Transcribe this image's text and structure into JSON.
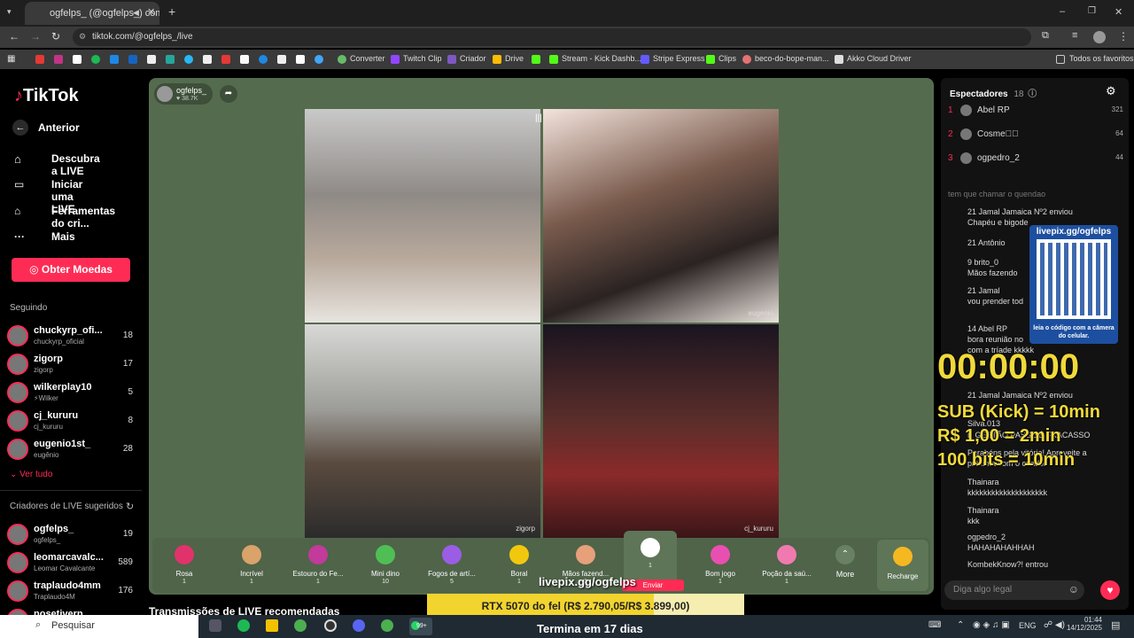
{
  "browser": {
    "tab_title": "ogfelps_ (@ogfelps_) come...",
    "url": "tiktok.com/@ogfelps_/live",
    "bookmarks": [
      "Converter",
      "Twitch Clip",
      "Criador",
      "Drive",
      "Stream - Kick Dashb...",
      "Stripe Express",
      "Clips",
      "beco-do-bope-man...",
      "Akko Cloud Driver",
      "Todos os favoritos"
    ]
  },
  "sidebar": {
    "logo": "TikTok",
    "back": "Anterior",
    "nav": [
      "Descubra a LIVE",
      "Iniciar uma LIVE",
      "Ferramentas do cri...",
      "Mais"
    ],
    "coins_button": "Obter Moedas",
    "following_title": "Seguindo",
    "following": [
      {
        "name": "chuckyrp_ofi...",
        "sub": "chuckyrp_oficial",
        "count": "18"
      },
      {
        "name": "zigorp",
        "sub": "zigorp",
        "count": "17"
      },
      {
        "name": "wilkerplay10",
        "sub": "⚡Wilker",
        "count": "5"
      },
      {
        "name": "cj_kururu",
        "sub": "cj_kururu",
        "count": "8"
      },
      {
        "name": "eugenio1st_",
        "sub": "eugênio",
        "count": "28"
      }
    ],
    "see_all": "Ver tudo",
    "suggested_title": "Criadores de LIVE sugeridos",
    "suggested": [
      {
        "name": "ogfelps_",
        "sub": "ogfelps_",
        "count": "19"
      },
      {
        "name": "leomarcavalc...",
        "sub": "Leomar Cavalcante",
        "count": "589"
      },
      {
        "name": "traplaudo4mm",
        "sub": "Traplaudo4M",
        "count": "176"
      },
      {
        "name": "nosetiverp",
        "sub": "",
        "count": ""
      }
    ]
  },
  "stream": {
    "host": "ogfelps_",
    "likes": "38.7K",
    "tiles": [
      "",
      "eugenio",
      "zigorp",
      "cj_kururu"
    ],
    "recommended_title": "Transmissões de LIVE recomendadas",
    "overlay_link": "livepix.gg/ogfelps",
    "goal": "RTX 5070 do fel (R$ 2.790,05/R$ 3.899,00)",
    "goal_progress": 0.7156,
    "ends": "Termina em 17 dias"
  },
  "gifts": [
    {
      "name": "Rosa",
      "cost": "1",
      "color": "#e0336b"
    },
    {
      "name": "Incrível",
      "cost": "1",
      "color": "#d9a36a"
    },
    {
      "name": "Estouro do Fe...",
      "cost": "1",
      "color": "#c23a9a"
    },
    {
      "name": "Mini dino",
      "cost": "10",
      "color": "#4fbf55"
    },
    {
      "name": "Fogos de artí...",
      "cost": "5",
      "color": "#9b5de5"
    },
    {
      "name": "Boral",
      "cost": "1",
      "color": "#f2c80f"
    },
    {
      "name": "Mãos fazend...",
      "cost": "1",
      "color": "#e6a07a"
    },
    {
      "name": "",
      "cost": "1",
      "color": "#ffffff"
    },
    {
      "name": "Bom jogo",
      "cost": "1",
      "color": "#e94fb0"
    },
    {
      "name": "Poção da saú...",
      "cost": "1",
      "color": "#f07ab0"
    }
  ],
  "gift_send": "Enviar",
  "gift_more": "More",
  "recharge": "Recharge",
  "panel": {
    "viewers_title": "Espectadores",
    "viewers_count": "18",
    "top": [
      {
        "rank": "1",
        "name": "Abel RP",
        "score": "321"
      },
      {
        "rank": "2",
        "name": "Cosme\u0000\u0000",
        "score": "64"
      },
      {
        "rank": "3",
        "name": "ogpedro_2",
        "score": "44"
      }
    ],
    "chat": [
      "tem que chamar o quendao",
      "21  Jamal Jamaica  Nº2 enviou",
      "Chapéu e bigode",
      "21 Antônio",
      "9  brito_0",
      "Mãos fazendo",
      "21  Jamal",
      "vou prender tod",
      "14 Abel RP",
      "bora reunião no",
      "com a tríade kkkkk",
      "21  Jamal Jamaica  Nº2 enviou",
      "Silva.013",
      "É GESTÃO PASSE É FRACASSO",
      "Parabéns pela vitória! Aproveite a",
      "próxima com o criador",
      "Thainara",
      "kkkkkkkkkkkkkkkkkkkk",
      "Thainara",
      "kkk",
      "ogpedro_2",
      "HAHAHAHAHHAH",
      "KombekKnow?! entrou"
    ],
    "input_placeholder": "Diga algo legal",
    "qr_title": "livepix.gg/ogfelps",
    "qr_sub": "leia o código com a câmera do celular.",
    "timer": "00:00:00",
    "rates": [
      "SUB (Kick) = 10min",
      "R$ 1,00 = 2min",
      "100 bits = 10min"
    ]
  },
  "taskbar": {
    "search": "Pesquisar",
    "badge": "99+",
    "lang": "ENG",
    "time": "01:44",
    "date": "14/12/2025"
  }
}
